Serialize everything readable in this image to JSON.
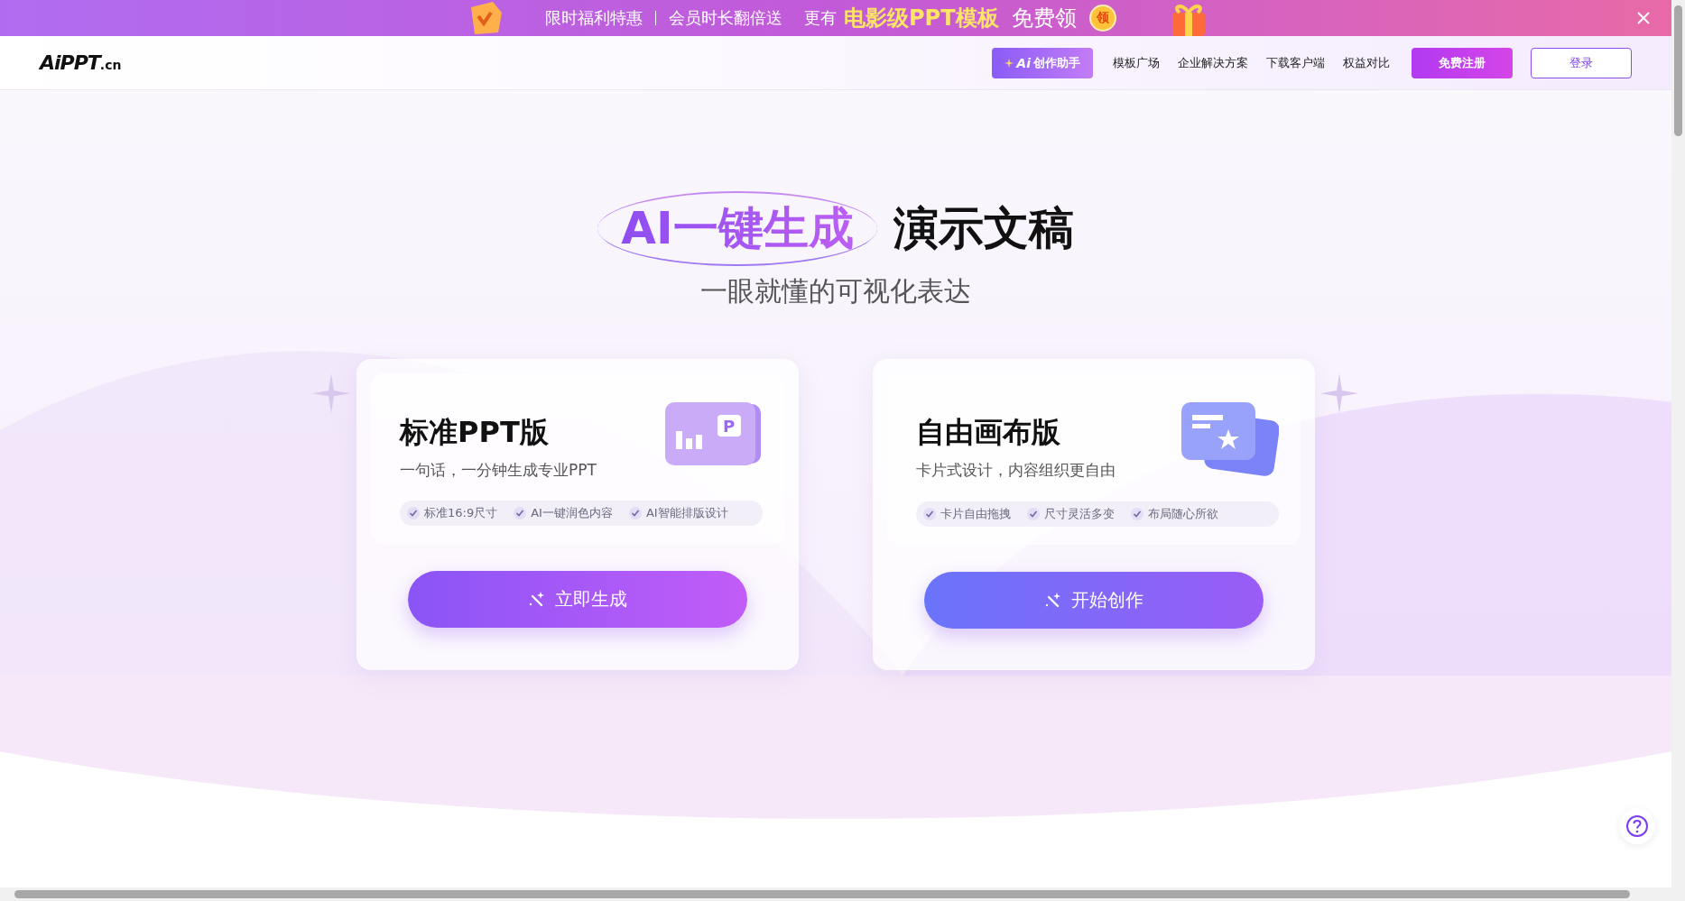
{
  "promo_banner": {
    "texts": [
      "限时福利特惠",
      "会员时长翻倍送"
    ],
    "lead": "更有",
    "highlight": "电影级PPT模板",
    "offer": "免费领",
    "badge": "领"
  },
  "header": {
    "logo": {
      "main": "AiPPT",
      "suffix": ".cn"
    },
    "assistant_button": {
      "prefix": "Ai",
      "label": "创作助手"
    },
    "nav_links": [
      "模板广场",
      "企业解决方案",
      "下载客户端",
      "权益对比"
    ],
    "register_button": "免费注册",
    "login_button": "登录"
  },
  "hero": {
    "title_highlight": "AI一键生成",
    "title_rest": "演示文稿",
    "subtitle": "一眼就懂的可视化表达"
  },
  "cards": [
    {
      "kind": "standard",
      "icon_letter": "P",
      "title": "标准PPT版",
      "description": "一句话，一分钟生成专业PPT",
      "features": [
        "标准16:9尺寸",
        "AI一键润色内容",
        "AI智能排版设计"
      ],
      "button": "立即生成"
    },
    {
      "kind": "canvas",
      "title": "自由画布版",
      "description": "卡片式设计，内容组织更自由",
      "features": [
        "卡片自由拖拽",
        "尺寸灵活多变",
        "布局随心所欲"
      ],
      "button": "开始创作"
    }
  ]
}
